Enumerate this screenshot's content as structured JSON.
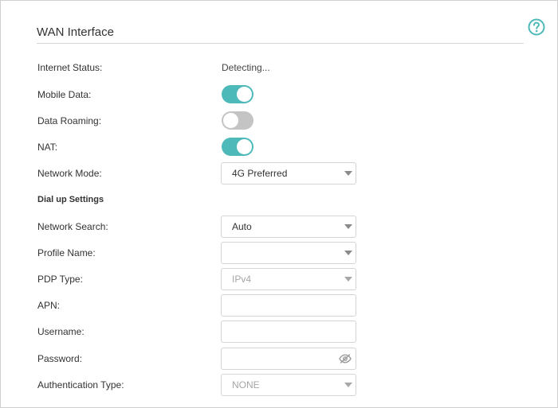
{
  "section": {
    "title": "WAN Interface"
  },
  "help_icon": "question-circle-icon",
  "rows": {
    "internet_status": {
      "label": "Internet Status:",
      "value": "Detecting..."
    },
    "mobile_data": {
      "label": "Mobile Data:",
      "state": "on"
    },
    "data_roaming": {
      "label": "Data Roaming:",
      "state": "off"
    },
    "nat": {
      "label": "NAT:",
      "state": "on"
    },
    "network_mode": {
      "label": "Network Mode:",
      "value": "4G Preferred"
    }
  },
  "dialup": {
    "heading": "Dial up Settings",
    "network_search": {
      "label": "Network Search:",
      "value": "Auto"
    },
    "profile_name": {
      "label": "Profile Name:",
      "value": ""
    },
    "pdp_type": {
      "label": "PDP Type:",
      "value": "IPv4"
    },
    "apn": {
      "label": "APN:",
      "value": ""
    },
    "username": {
      "label": "Username:",
      "value": ""
    },
    "password": {
      "label": "Password:",
      "value": "",
      "icon": "eye-slash-icon"
    },
    "auth_type": {
      "label": "Authentication Type:",
      "value": "NONE"
    }
  },
  "colors": {
    "accent": "#4dbab9",
    "toggle_off": "#c4c4c4",
    "border": "#d4d4d4",
    "disabled_text": "#a6a6a6"
  }
}
